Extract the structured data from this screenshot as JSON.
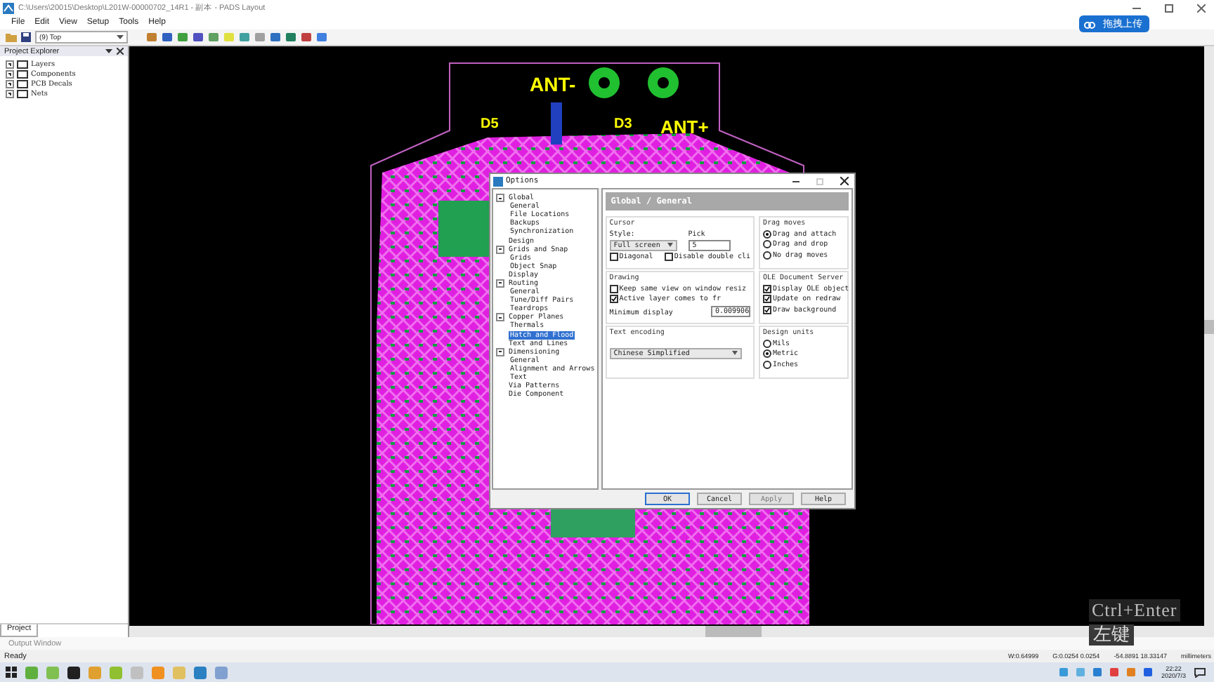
{
  "window": {
    "title": "C:\\Users\\20015\\Desktop\\L201W-00000702_14R1 - 副本 - PADS Layout",
    "upload_button": "拖拽上传"
  },
  "menu": [
    "File",
    "Edit",
    "View",
    "Setup",
    "Tools",
    "Help"
  ],
  "toolbar": {
    "layer": "(9) Top"
  },
  "project_explorer": {
    "title": "Project Explorer",
    "items": [
      {
        "label": "Layers",
        "expanded": false
      },
      {
        "label": "Components",
        "expanded": false
      },
      {
        "label": "PCB Decals",
        "expanded": false
      },
      {
        "label": "Nets",
        "expanded": false
      }
    ],
    "tab": "Project"
  },
  "canvas": {
    "labels": [
      "ANT-",
      "D5",
      "D3",
      "ANT+"
    ]
  },
  "dialog": {
    "title": "Options",
    "page_title": "Global / General",
    "tree": [
      {
        "label": "Global",
        "expanded": true,
        "selected": false,
        "children": [
          {
            "label": "General",
            "selected": false
          },
          {
            "label": "File Locations",
            "selected": false
          },
          {
            "label": "Backups",
            "selected": false
          },
          {
            "label": "Synchronization",
            "selected": false
          }
        ]
      },
      {
        "label": "Design",
        "selected": false
      },
      {
        "label": "Grids and Snap",
        "expanded": true,
        "selected": false,
        "children": [
          {
            "label": "Grids",
            "selected": false
          },
          {
            "label": "Object Snap",
            "selected": false
          }
        ]
      },
      {
        "label": "Display",
        "selected": false
      },
      {
        "label": "Routing",
        "expanded": true,
        "selected": false,
        "children": [
          {
            "label": "General",
            "selected": false
          },
          {
            "label": "Tune/Diff Pairs",
            "selected": false
          },
          {
            "label": "Teardrops",
            "selected": false
          }
        ]
      },
      {
        "label": "Copper Planes",
        "expanded": true,
        "selected": false,
        "children": [
          {
            "label": "Thermals",
            "selected": false
          },
          {
            "label": "Hatch and Flood",
            "selected": true
          }
        ]
      },
      {
        "label": "Text and Lines",
        "selected": false
      },
      {
        "label": "Dimensioning",
        "expanded": true,
        "selected": false,
        "children": [
          {
            "label": "General",
            "selected": false
          },
          {
            "label": "Alignment and Arrows",
            "selected": false
          },
          {
            "label": "Text",
            "selected": false
          }
        ]
      },
      {
        "label": "Via Patterns",
        "selected": false
      },
      {
        "label": "Die Component",
        "selected": false
      }
    ],
    "cursor": {
      "title": "Cursor",
      "style_label": "Style:",
      "style_value": "Full screen",
      "pick_label": "Pick",
      "pick_value": "5",
      "options": [
        {
          "label": "Diagonal",
          "checked": false
        },
        {
          "label": "Disable double cli",
          "checked": false
        }
      ]
    },
    "drawing": {
      "title": "Drawing",
      "options": [
        {
          "label": "Keep same view on window resiz",
          "checked": false
        },
        {
          "label": "Active layer comes to fr",
          "checked": true
        }
      ],
      "min_label": "Minimum display",
      "min_value": "0.009906"
    },
    "text_encoding": {
      "title": "Text encoding",
      "value": "Chinese Simplified"
    },
    "drag_moves": {
      "title": "Drag moves",
      "options": [
        {
          "label": "Drag and attach",
          "selected": true
        },
        {
          "label": "Drag and drop",
          "selected": false
        },
        {
          "label": "No drag moves",
          "selected": false
        }
      ]
    },
    "ole": {
      "title": "OLE Document Server",
      "options": [
        {
          "label": "Display OLE object",
          "checked": true
        },
        {
          "label": "Update on redraw",
          "checked": true
        },
        {
          "label": "Draw background",
          "checked": true
        }
      ]
    },
    "design_units": {
      "title": "Design units",
      "options": [
        {
          "label": "Mils",
          "selected": false
        },
        {
          "label": "Metric",
          "selected": true
        },
        {
          "label": "Inches",
          "selected": false
        }
      ]
    },
    "buttons": [
      {
        "label": "OK",
        "disabled": false
      },
      {
        "label": "Cancel",
        "disabled": false
      },
      {
        "label": "Apply",
        "disabled": true
      },
      {
        "label": "Help",
        "disabled": false
      }
    ]
  },
  "output_window": "Output Window",
  "status_bar": {
    "text": "Ready",
    "width": "W:0.64999",
    "grid": "G:0.0254 0.0254",
    "coords": "-54.8891   18.33147",
    "units": "millimeters"
  },
  "taskbar": {
    "time": "22:22",
    "date": "2020/7/3"
  },
  "overlays": {
    "shortcut": "Ctrl+Enter",
    "mouse": "左键"
  }
}
